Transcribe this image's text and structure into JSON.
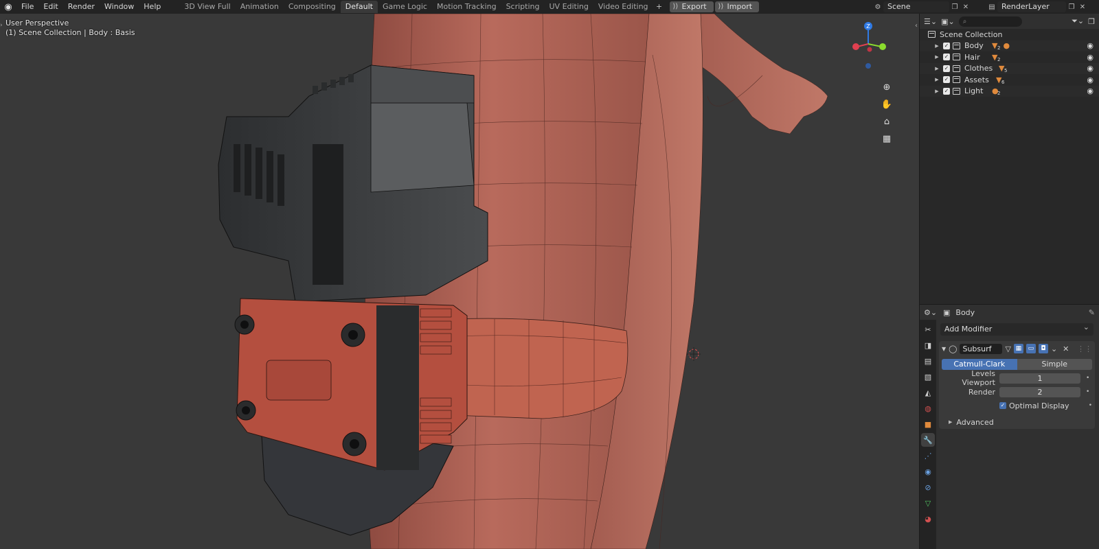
{
  "topbar": {
    "menus": [
      "File",
      "Edit",
      "Render",
      "Window",
      "Help"
    ],
    "workspaces": [
      "3D View Full",
      "Animation",
      "Compositing",
      "Default",
      "Game Logic",
      "Motion Tracking",
      "Scripting",
      "UV Editing",
      "Video Editing"
    ],
    "active_workspace": "Default",
    "export_label": "Export",
    "import_label": "Import",
    "scene_name": "Scene",
    "render_layer": "RenderLayer"
  },
  "viewport": {
    "perspective": "User Perspective",
    "collection_info": "(1) Scene Collection | Body : Basis",
    "gizmo_axis_label": "Z"
  },
  "outliner": {
    "root": "Scene Collection",
    "collections": [
      {
        "name": "Body",
        "count": "2"
      },
      {
        "name": "Hair",
        "count": "2"
      },
      {
        "name": "Clothes",
        "count": "5"
      },
      {
        "name": "Assets",
        "count": "6"
      },
      {
        "name": "Light",
        "count": "2"
      }
    ]
  },
  "properties": {
    "object_name": "Body",
    "add_modifier": "Add Modifier",
    "modifier": {
      "name": "Subsurf",
      "type_options": [
        "Catmull-Clark",
        "Simple"
      ],
      "type_selected": "Catmull-Clark",
      "levels_viewport_label": "Levels Viewport",
      "levels_viewport": "1",
      "render_label": "Render",
      "render": "2",
      "optimal_display_label": "Optimal Display",
      "advanced_label": "Advanced"
    }
  },
  "colors": {
    "accent_blue": "#4772b3",
    "collection_orange": "#e08a3c",
    "skin": "#b5665a",
    "holster_dark": "#3b3d3e",
    "holster_red": "#b44f3f"
  }
}
